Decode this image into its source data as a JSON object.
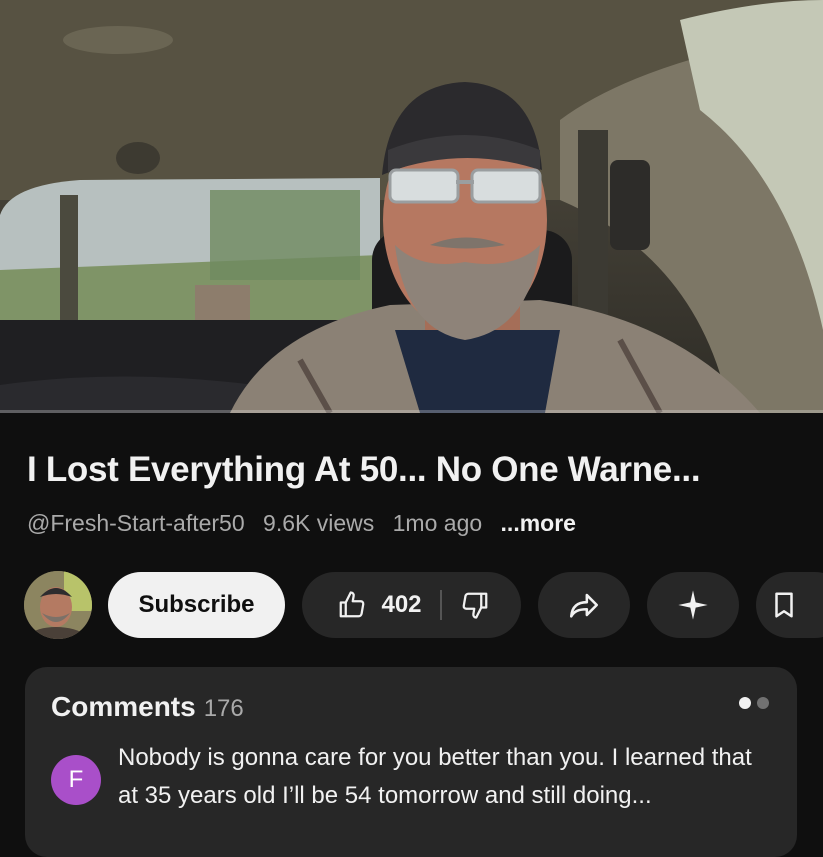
{
  "video": {
    "progress_fraction": 0.0
  },
  "title": "I Lost Everything At 50...  No One Warne...",
  "meta": {
    "channel_handle": "@Fresh-Start-after50",
    "views": "9.6K views",
    "age": "1mo ago",
    "more_label": "...more"
  },
  "actions": {
    "subscribe_label": "Subscribe",
    "like_count": "402"
  },
  "comments": {
    "header_label": "Comments",
    "count": "176",
    "top_comment": {
      "avatar_letter": "F",
      "avatar_color": "#a94fc9",
      "text": "Nobody is gonna care for you better than you. I learned that at 35 years old I’ll be 54 tomorrow and still doing..."
    }
  },
  "colors": {
    "background": "#0f0f0f",
    "pill": "#272727",
    "text_primary": "#f1f1f1",
    "text_secondary": "#aaaaaa"
  }
}
